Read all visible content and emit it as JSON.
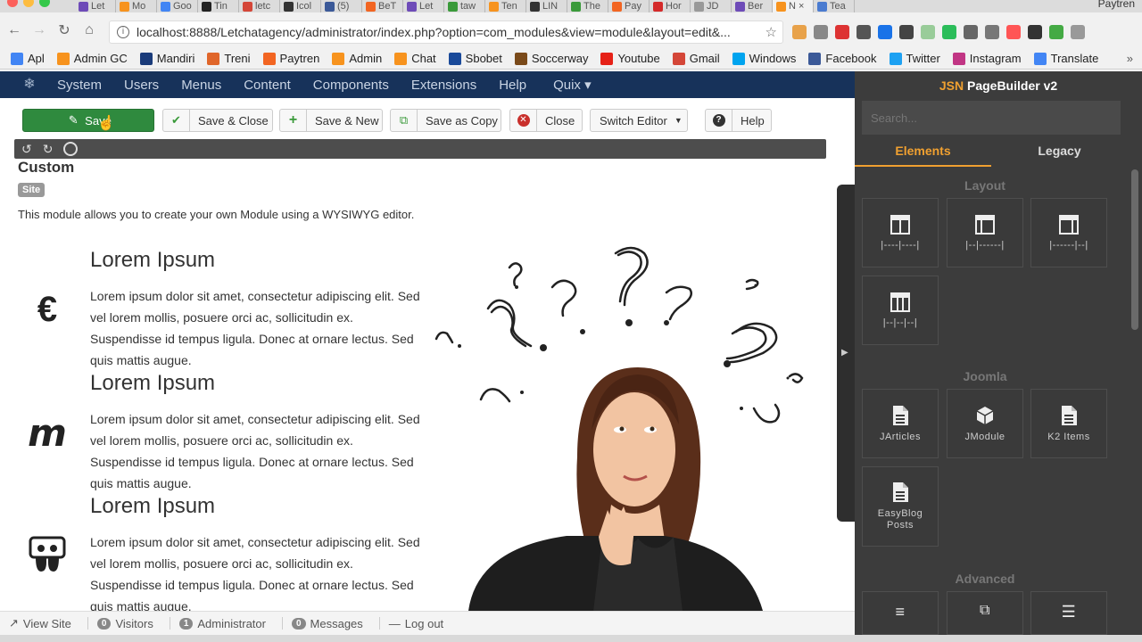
{
  "browser": {
    "tabs": [
      "Let",
      "Mo",
      "Goo",
      "Tin",
      "letc",
      "Icol",
      "(5)",
      "BeT",
      "Let",
      "taw",
      "Ten",
      "LIN",
      "The",
      "Pay",
      "Hor",
      "JD",
      "Ber",
      "N",
      "Tea"
    ],
    "profile": "Paytren",
    "url": "localhost:8888/Letchatagency/administrator/index.php?option=com_modules&view=module&layout=edit&...",
    "bookmarks": [
      {
        "label": "Apl",
        "color": "#4285f4"
      },
      {
        "label": "Admin GC",
        "color": "#f7931e"
      },
      {
        "label": "Mandiri",
        "color": "#1a3b7a"
      },
      {
        "label": "Treni",
        "color": "#e0662a"
      },
      {
        "label": "Paytren",
        "color": "#f26522"
      },
      {
        "label": "Admin",
        "color": "#f7931e"
      },
      {
        "label": "Chat",
        "color": "#f7931e"
      },
      {
        "label": "Sbobet",
        "color": "#1a4a9a"
      },
      {
        "label": "Soccerway",
        "color": "#7a4a1a"
      },
      {
        "label": "Youtube",
        "color": "#e62117"
      },
      {
        "label": "Gmail",
        "color": "#d44638"
      },
      {
        "label": "Windows",
        "color": "#00a4ef"
      },
      {
        "label": "Facebook",
        "color": "#3b5998"
      },
      {
        "label": "Twitter",
        "color": "#1da1f2"
      },
      {
        "label": "Instagram",
        "color": "#c13584"
      },
      {
        "label": "Translate",
        "color": "#4285f4"
      }
    ]
  },
  "adminnav": {
    "items": [
      "System",
      "Users",
      "Menus",
      "Content",
      "Components",
      "Extensions",
      "Help",
      "Quix ▾"
    ]
  },
  "toolbar": {
    "save": "Save",
    "save_close": "Save & Close",
    "save_new": "Save & New",
    "save_copy": "Save as Copy",
    "close": "Close",
    "switch_editor": "Switch Editor",
    "help": "Help"
  },
  "module": {
    "title": "Custom",
    "badge": "Site",
    "description": "This module allows you to create your own Module using a WYSIWYG editor."
  },
  "features": [
    {
      "heading": "Lorem Ipsum",
      "icon": "euro-icon",
      "glyph": "€",
      "text": "Lorem ipsum dolor sit amet, consectetur adipiscing elit. Sed vel lorem mollis, posuere orci ac, sollicitudin ex. Suspendisse id tempus ligula. Donec at ornare lectus. Sed quis mattis augue."
    },
    {
      "heading": "Lorem Ipsum",
      "icon": "m-brand-icon",
      "glyph": "m",
      "text": "Lorem ipsum dolor sit amet, consectetur adipiscing elit. Sed vel lorem mollis, posuere orci ac, sollicitudin ex. Suspendisse id tempus ligula. Donec at ornare lectus. Sed quis mattis augue."
    },
    {
      "heading": "Lorem Ipsum",
      "icon": "slideshare-icon",
      "glyph": "",
      "text": "Lorem ipsum dolor sit amet, consectetur adipiscing elit. Sed vel lorem mollis, posuere orci ac, sollicitudin ex. Suspendisse id tempus ligula. Donec at ornare lectus. Sed quis mattis augue."
    }
  ],
  "statusbar": {
    "view_site": "View Site",
    "visitors_count": "0",
    "visitors": "Visitors",
    "admin_count": "1",
    "admin": "Administrator",
    "messages_count": "0",
    "messages": "Messages",
    "logout": "Log out"
  },
  "pagebuilder": {
    "brand": "JSN",
    "title": "PageBuilder v2",
    "search_placeholder": "Search...",
    "tabs": [
      "Elements",
      "Legacy"
    ],
    "sections": {
      "layout": "Layout",
      "joomla": "Joomla",
      "advanced": "Advanced"
    },
    "layout_items": [
      "|----|----|",
      "|--|------|",
      "|------|--|",
      "|--|--|--|"
    ],
    "joomla_items": [
      "JArticles",
      "JModule",
      "K2 Items",
      "EasyBlog Posts"
    ]
  },
  "colors": {
    "admin_nav": "#17325a",
    "save_green": "#2f8a3e",
    "pb_accent": "#f0a030",
    "pb_bg": "#3c3c3c"
  }
}
